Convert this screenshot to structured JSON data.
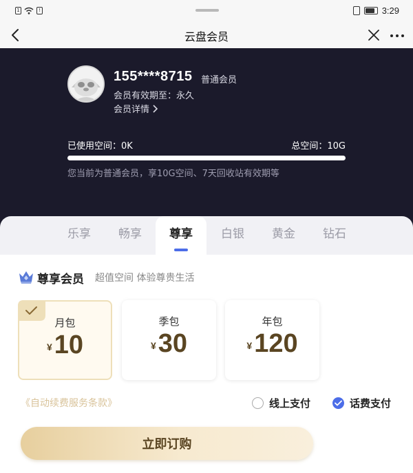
{
  "status_bar": {
    "sim1": "1",
    "sim2": "!",
    "time": "3:29",
    "battery_level": 0.85
  },
  "nav": {
    "title": "云盘会员"
  },
  "profile": {
    "phone": "155****8715",
    "member_type": "普通会员",
    "validity": "会员有效期至：永久",
    "details_link": "会员详情"
  },
  "storage": {
    "used_label": "已使用空间：0K",
    "total_label": "总空间：10G",
    "used_fraction": 0,
    "hint": "您当前为普通会员，享10G空间、7天回收站有效期等"
  },
  "tiers": {
    "tabs": [
      "乐享",
      "畅享",
      "尊享",
      "白银",
      "黄金",
      "钻石"
    ],
    "active_index": 2
  },
  "tier_info": {
    "title": "尊享会员",
    "slogan": "超值空间 体验尊贵生活"
  },
  "plans": [
    {
      "name": "月包",
      "currency": "¥",
      "price": "10",
      "selected": true
    },
    {
      "name": "季包",
      "currency": "¥",
      "price": "30",
      "selected": false
    },
    {
      "name": "年包",
      "currency": "¥",
      "price": "120",
      "selected": false
    }
  ],
  "payment": {
    "terms_link": "《自动续费服务条款》",
    "options": [
      {
        "label": "线上支付",
        "selected": false
      },
      {
        "label": "话费支付",
        "selected": true
      }
    ]
  },
  "purchase": {
    "button_label": "立即订购"
  },
  "colors": {
    "header_bg": "#1b1a2b",
    "accent_blue": "#4c6de8",
    "gold_text": "#5a4522",
    "gold_light": "#eedfb9"
  }
}
